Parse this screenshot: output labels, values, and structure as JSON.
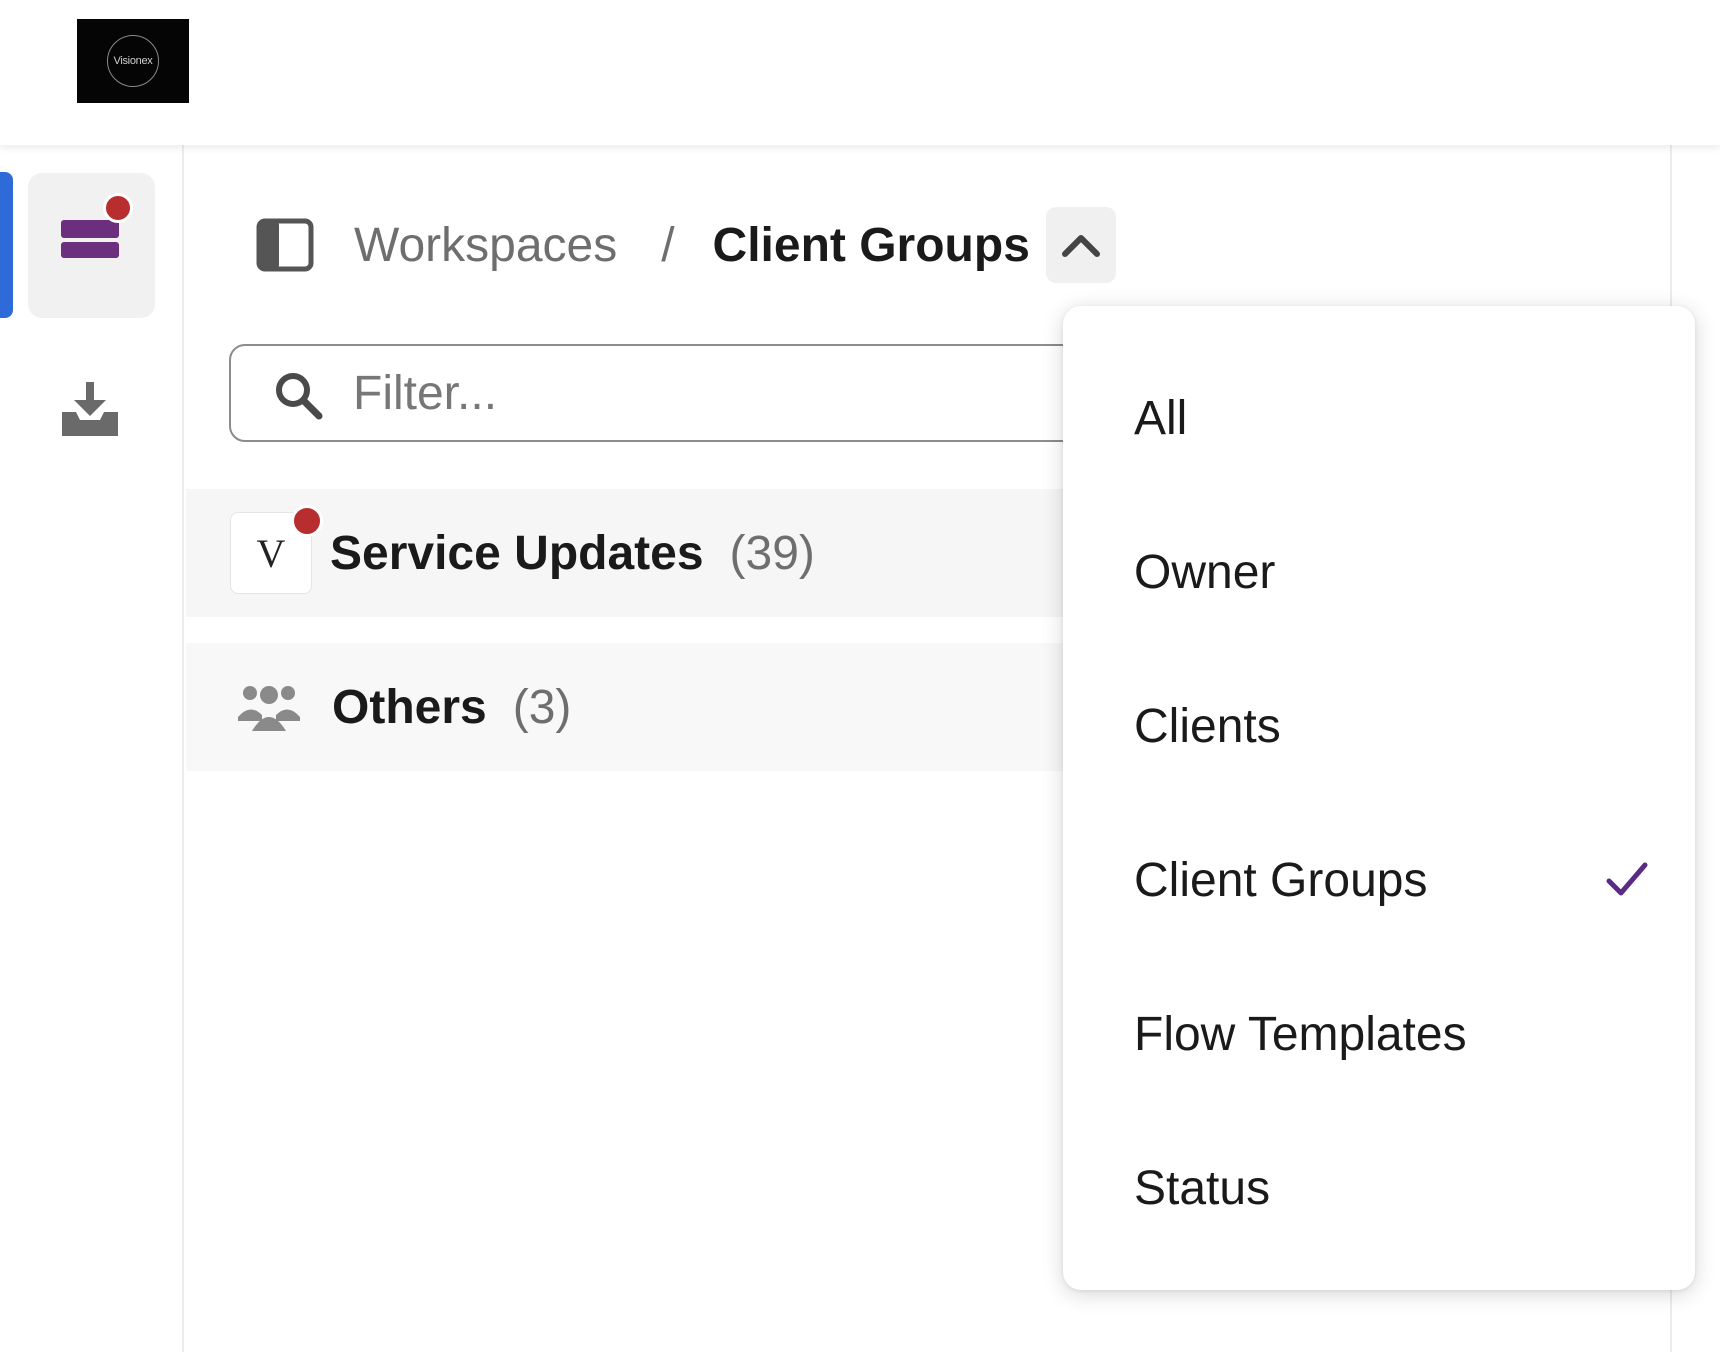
{
  "header": {
    "logo_text": "Visionex"
  },
  "breadcrumb": {
    "workspaces_label": "Workspaces",
    "separator": "/",
    "current_label": "Client Groups"
  },
  "filter": {
    "placeholder": "Filter...",
    "value": ""
  },
  "list": [
    {
      "label": "Service Updates",
      "count": "(39)",
      "avatar_text": "V"
    },
    {
      "label": "Others",
      "count": "(3)"
    }
  ],
  "dropdown": {
    "items": [
      "All",
      "Owner",
      "Clients",
      "Client Groups",
      "Flow Templates",
      "Status"
    ],
    "selected": "Client Groups"
  },
  "colors": {
    "accent_purple": "#6b2f7e",
    "notification_red": "#b82e2e",
    "active_indicator_blue": "#2f6bd8",
    "check_purple": "#5b2a86"
  },
  "icons": {
    "rail": [
      "inbox-icon",
      "download-icon"
    ],
    "breadcrumb": [
      "sidebar-panel-icon",
      "chevron-up-icon"
    ],
    "filter": "search-icon",
    "others_row": "group-icon",
    "selected_mark": "checkmark-icon"
  }
}
